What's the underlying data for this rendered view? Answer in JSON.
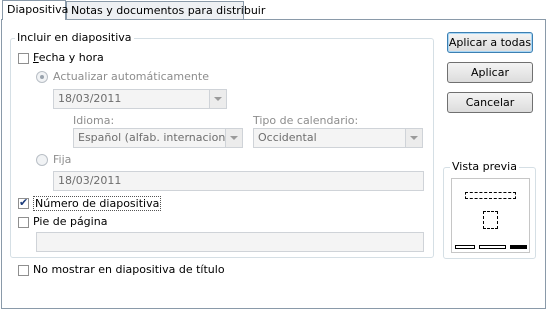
{
  "tabs": [
    {
      "label": "Diapositiva",
      "active": true
    },
    {
      "label": "Notas y documentos para distribuir",
      "active": false
    }
  ],
  "group": {
    "title": "Incluir en diapositiva"
  },
  "fecha_hora": {
    "label": "Fecha y hora",
    "checked": false
  },
  "actualizar": {
    "label": "Actualizar automáticamente",
    "selected": true,
    "date_value": "18/03/2011"
  },
  "idioma": {
    "label": "Idioma:",
    "value": "Español (alfab. internacional)"
  },
  "calendario": {
    "label": "Tipo de calendario:",
    "value": "Occidental"
  },
  "fija": {
    "label": "Fija",
    "selected": false,
    "value": "18/03/2011"
  },
  "numero": {
    "label": "Número de diapositiva",
    "checked": true
  },
  "pie": {
    "label": "Pie de página",
    "checked": false,
    "value": ""
  },
  "no_mostrar": {
    "label": "No mostrar en diapositiva de título",
    "checked": false
  },
  "buttons": {
    "apply_all": "Aplicar a todas",
    "apply": "Aplicar",
    "cancel": "Cancelar"
  },
  "preview": {
    "title": "Vista previa"
  },
  "colors": {
    "tab_border": "#8a9aa9",
    "group_border": "#d5dfe5",
    "default_button_border": "#3c7fb1"
  }
}
